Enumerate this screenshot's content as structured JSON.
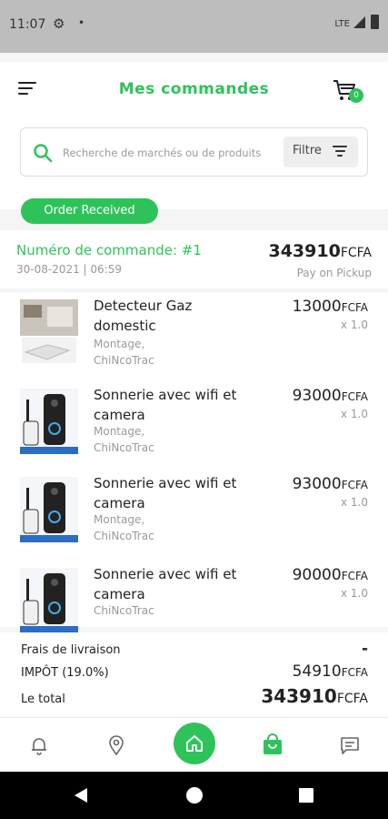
{
  "status_bar": {
    "time": "11:07",
    "network": "LTE"
  },
  "header": {
    "title": "Mes commandes",
    "cart_count": "0"
  },
  "search": {
    "placeholder": "Recherche de marchés ou de produits",
    "filter_label": "Filtre"
  },
  "order": {
    "status": "Order Received",
    "number": "Numéro de commande: #1",
    "date": "30-08-2021 | 06:59",
    "total_amount": "343910",
    "currency": "FCFA",
    "payment_method": "Pay on Pickup"
  },
  "items": [
    {
      "name_line1": "Detecteur Gaz",
      "name_line2": "domestic",
      "sub_line1": "Montage,",
      "sub_line2": "ChiNcoTrac",
      "price": "13000",
      "currency": "FCFA",
      "qty": "x 1.0",
      "thumb_icon": "gas-detector-icon"
    },
    {
      "name_line1": "Sonnerie avec wifi et",
      "name_line2": "camera",
      "sub_line1": "Montage,",
      "sub_line2": "ChiNcoTrac",
      "price": "93000",
      "currency": "FCFA",
      "qty": "x 1.0",
      "thumb_icon": "doorbell-camera-icon"
    },
    {
      "name_line1": "Sonnerie avec wifi et",
      "name_line2": "camera",
      "sub_line1": "Montage,",
      "sub_line2": "ChiNcoTrac",
      "price": "93000",
      "currency": "FCFA",
      "qty": "x 1.0",
      "thumb_icon": "doorbell-camera-icon"
    },
    {
      "name_line1": "Sonnerie avec wifi et",
      "name_line2": "camera",
      "sub_line1": "ChiNcoTrac",
      "price": "90000",
      "currency": "FCFA",
      "qty": "x 1.0",
      "thumb_icon": "doorbell-camera-icon"
    }
  ],
  "summary": {
    "delivery_label": "Frais de livraison",
    "delivery_value": "-",
    "tax_label": "IMPÔT (19.0%)",
    "tax_value": "54910",
    "tax_currency": "FCFA",
    "total_label": "Le total",
    "total_value": "343910",
    "total_currency": "FCFA"
  },
  "bottom_nav": {
    "items": [
      "bell-icon",
      "location-pin-icon",
      "home-icon",
      "shopping-bag-icon",
      "chat-icon"
    ],
    "active": "shopping-bag-icon"
  },
  "colors": {
    "accent": "#2ec35a",
    "muted_text": "#999999"
  }
}
